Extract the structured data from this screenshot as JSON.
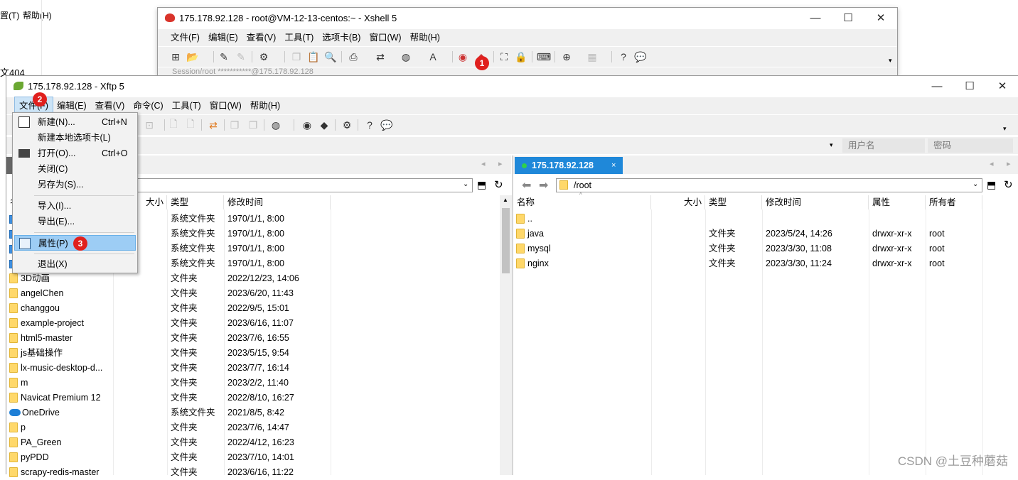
{
  "background_app": {
    "menu_partial": "置(T)",
    "help": "帮助(H)",
    "partial_text": "文404"
  },
  "xshell": {
    "title": "175.178.92.128 - root@VM-12-13-centos:~ - Xshell 5",
    "menu": [
      "文件(F)",
      "编辑(E)",
      "查看(V)",
      "工具(T)",
      "选项卡(B)",
      "窗口(W)",
      "帮助(H)"
    ],
    "session_hint": "Session/root  ***********@175.178.92.128",
    "badge": "1"
  },
  "xftp": {
    "title": "175.178.92.128   - Xftp 5",
    "menu": [
      "文件(F)",
      "编辑(E)",
      "查看(V)",
      "命令(C)",
      "工具(T)",
      "窗口(W)",
      "帮助(H)"
    ],
    "username_placeholder": "用户名",
    "password_placeholder": "密码",
    "badge_file": "2",
    "badge_props": "3",
    "file_menu": {
      "new": "新建(N)...",
      "new_sc": "Ctrl+N",
      "new_local_tab": "新建本地选项卡(L)",
      "open": "打开(O)...",
      "open_sc": "Ctrl+O",
      "close": "关闭(C)",
      "save_as": "另存为(S)...",
      "import": "导入(I)...",
      "export": "导出(E)...",
      "properties": "属性(P)",
      "exit": "退出(X)"
    },
    "left": {
      "columns": {
        "name": "名",
        "size": "大小",
        "type": "类型",
        "modified": "修改时间"
      },
      "rows": [
        {
          "name": "",
          "type": "系统文件夹",
          "modified": "1970/1/1, 8:00",
          "icon": "system"
        },
        {
          "name": "",
          "type": "系统文件夹",
          "modified": "1970/1/1, 8:00",
          "icon": "system"
        },
        {
          "name": "",
          "type": "系统文件夹",
          "modified": "1970/1/1, 8:00",
          "icon": "system"
        },
        {
          "name": "",
          "type": "系统文件夹",
          "modified": "1970/1/1, 8:00",
          "icon": "system"
        },
        {
          "name": "3D动画",
          "type": "文件夹",
          "modified": "2022/12/23, 14:06",
          "icon": "folder"
        },
        {
          "name": "angelChen",
          "type": "文件夹",
          "modified": "2023/6/20, 11:43",
          "icon": "folder"
        },
        {
          "name": "changgou",
          "type": "文件夹",
          "modified": "2022/9/5, 15:01",
          "icon": "folder"
        },
        {
          "name": "example-project",
          "type": "文件夹",
          "modified": "2023/6/16, 11:07",
          "icon": "folder"
        },
        {
          "name": "html5-master",
          "type": "文件夹",
          "modified": "2023/7/6, 16:55",
          "icon": "folder"
        },
        {
          "name": "js基础操作",
          "type": "文件夹",
          "modified": "2023/5/15, 9:54",
          "icon": "folder"
        },
        {
          "name": "lx-music-desktop-d...",
          "type": "文件夹",
          "modified": "2023/7/7, 16:14",
          "icon": "folder"
        },
        {
          "name": "m",
          "type": "文件夹",
          "modified": "2023/2/2, 11:40",
          "icon": "folder"
        },
        {
          "name": "Navicat Premium 12",
          "type": "文件夹",
          "modified": "2022/8/10, 16:27",
          "icon": "folder"
        },
        {
          "name": "OneDrive",
          "type": "系统文件夹",
          "modified": "2021/8/5, 8:42",
          "icon": "cloud"
        },
        {
          "name": "p",
          "type": "文件夹",
          "modified": "2023/7/6, 14:47",
          "icon": "folder"
        },
        {
          "name": "PA_Green",
          "type": "文件夹",
          "modified": "2022/4/12, 16:23",
          "icon": "folder"
        },
        {
          "name": "pyPDD",
          "type": "文件夹",
          "modified": "2023/7/10, 14:01",
          "icon": "folder"
        },
        {
          "name": "scrapy-redis-master",
          "type": "文件夹",
          "modified": "2023/6/16, 11:22",
          "icon": "folder"
        }
      ]
    },
    "right": {
      "tab_label": "175.178.92.128",
      "tab_close": "×",
      "path": "/root",
      "columns": {
        "name": "名称",
        "size": "大小",
        "type": "类型",
        "modified": "修改时间",
        "attr": "属性",
        "owner": "所有者"
      },
      "rows": [
        {
          "name": "..",
          "type": "",
          "modified": "",
          "attr": "",
          "owner": ""
        },
        {
          "name": "java",
          "type": "文件夹",
          "modified": "2023/5/24, 14:26",
          "attr": "drwxr-xr-x",
          "owner": "root"
        },
        {
          "name": "mysql",
          "type": "文件夹",
          "modified": "2023/3/30, 11:08",
          "attr": "drwxr-xr-x",
          "owner": "root"
        },
        {
          "name": "nginx",
          "type": "文件夹",
          "modified": "2023/3/30, 11:24",
          "attr": "drwxr-xr-x",
          "owner": "root"
        }
      ]
    }
  },
  "watermark": "CSDN @土豆种蘑菇",
  "colors": {
    "tab_blue": "#1f88d9",
    "badge_red": "#e0201e",
    "highlight": "#9dcdf5"
  }
}
